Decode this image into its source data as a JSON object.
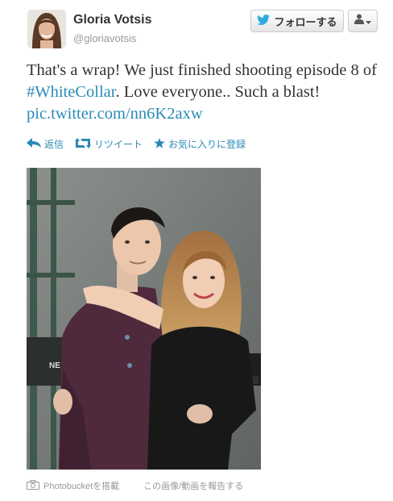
{
  "user": {
    "name": "Gloria Votsis",
    "handle": "@gloriavotsis"
  },
  "header": {
    "follow_label": "フォローする"
  },
  "tweet": {
    "text_before": "That's a wrap! We just finished shooting episode 8 of ",
    "hashtag": "#WhiteCollar",
    "text_middle": ". Love everyone.. Such a blast! ",
    "link": "pic.twitter.com/nn6K2axw"
  },
  "actions": {
    "reply": "返信",
    "retweet": "リツイート",
    "favorite": "お気に入りに登録"
  },
  "media": {
    "photo_text": "NE"
  },
  "footer": {
    "source": "Photobucketを搭載",
    "report": "この画像/動画を報告する"
  },
  "colors": {
    "link": "#2a8ab6",
    "twitter_bird": "#2fa9e0"
  }
}
